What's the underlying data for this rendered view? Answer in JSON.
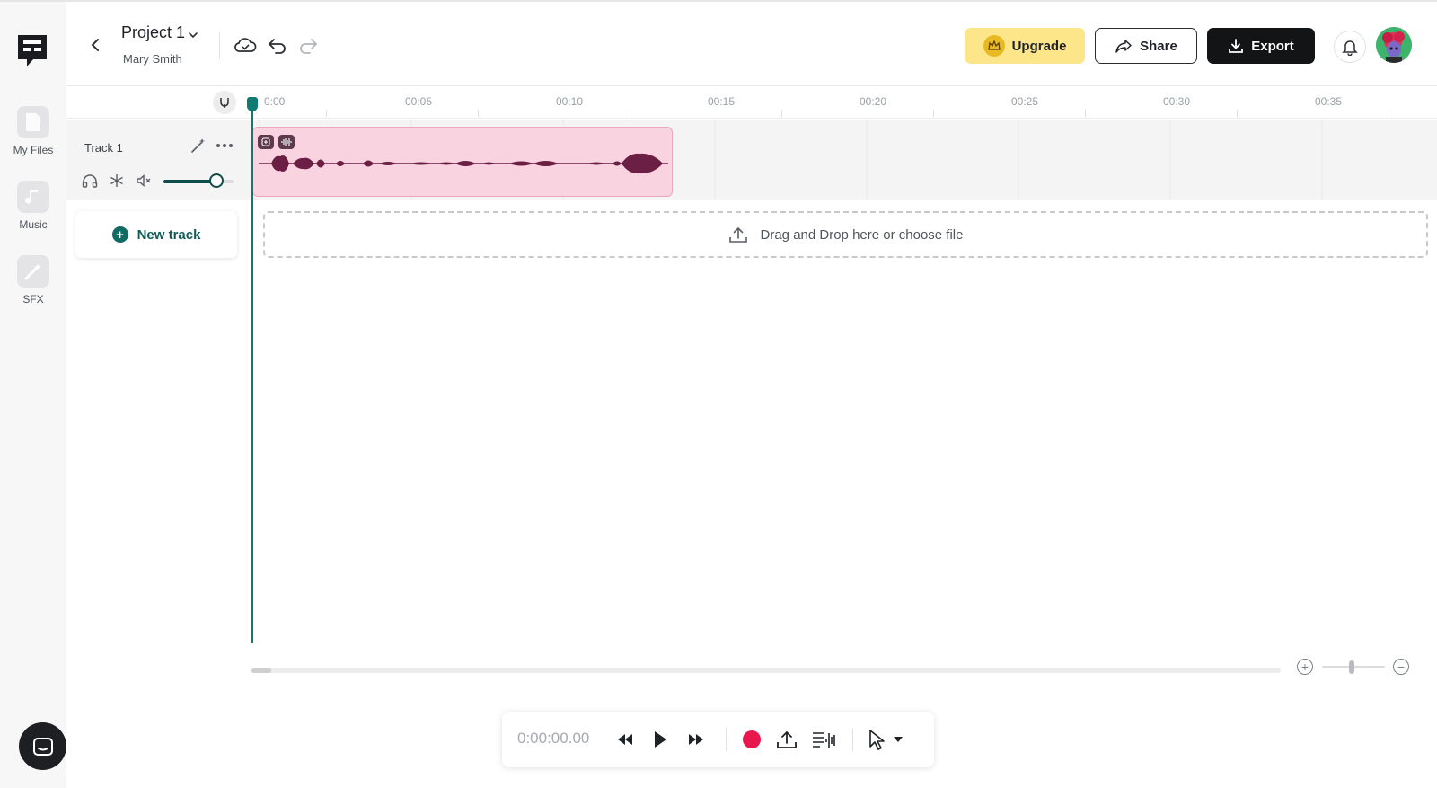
{
  "header": {
    "project_title": "Project 1",
    "owner": "Mary Smith",
    "upgrade_label": "Upgrade",
    "share_label": "Share",
    "export_label": "Export"
  },
  "rail": {
    "items": [
      {
        "label": "My Files",
        "icon": "file-icon"
      },
      {
        "label": "Music",
        "icon": "music-note-icon"
      },
      {
        "label": "SFX",
        "icon": "magic-wand-icon"
      }
    ]
  },
  "ruler": {
    "ticks": [
      "0:00",
      "00:05",
      "00:10",
      "00:15",
      "00:20",
      "00:25",
      "00:30",
      "00:35"
    ]
  },
  "track": {
    "name": "Track 1",
    "volume": 0.75
  },
  "new_track_label": "New track",
  "dropzone_label": "Drag and Drop here or choose file",
  "transport": {
    "timecode": "0:00:00.00"
  },
  "colors": {
    "accent": "#0e7a72",
    "clip_fill": "#f9d3e0",
    "waveform": "#6b1f44",
    "record": "#e8174c",
    "upgrade": "#fde68a"
  }
}
